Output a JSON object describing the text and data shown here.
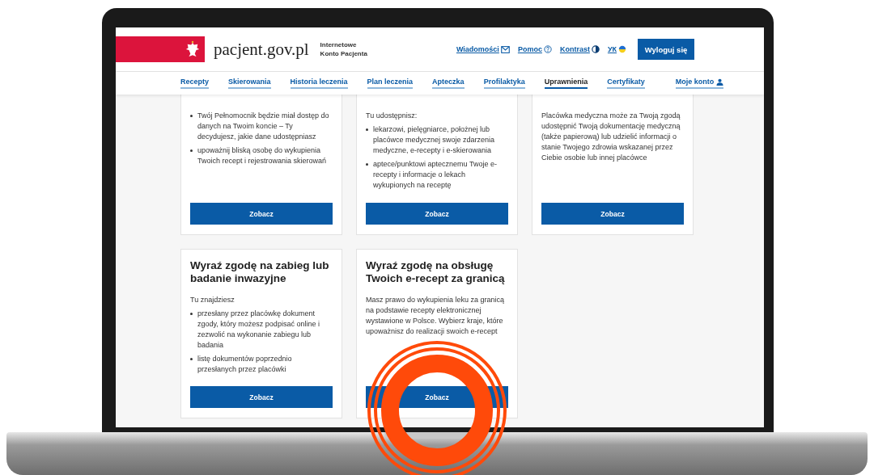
{
  "header": {
    "logo_text": "pacjent.gov.pl",
    "logo_subtitle": [
      "Internetowe",
      "Konto Pacjenta"
    ],
    "top_links": [
      {
        "label": "Wiadomości",
        "kind": "mail"
      },
      {
        "label": "Pomoc",
        "kind": "help"
      },
      {
        "label": "Kontrast",
        "kind": "contrast"
      },
      {
        "label": "УК",
        "kind": "flag"
      }
    ],
    "logout_button": "Wyloguj się"
  },
  "nav": {
    "items": [
      {
        "label": "Recepty",
        "selected": false
      },
      {
        "label": "Skierowania",
        "selected": false
      },
      {
        "label": "Historia leczenia",
        "selected": false
      },
      {
        "label": "Plan leczenia",
        "selected": false
      },
      {
        "label": "Apteczka",
        "selected": false
      },
      {
        "label": "Profilaktyka",
        "selected": false
      },
      {
        "label": "Uprawnienia",
        "selected": true
      },
      {
        "label": "Certyfikaty",
        "selected": false
      }
    ],
    "account_link": "Moje konto"
  },
  "cards": [
    {
      "bullets": [
        "Twój Pełnomocnik będzie miał dostęp do danych na Twoim koncie – Ty decydujesz, jakie dane udostępniasz",
        "upoważnij bliską osobę do wykupienia Twoich recept i rejestrowania skierowań"
      ],
      "button": "Zobacz"
    },
    {
      "intro": "Tu udostępnisz:",
      "bullets": [
        "lekarzowi, pielęgniarce, położnej lub placówce medycznej swoje zdarzenia medyczne, e-recepty i e-skierowania",
        "aptece/punktowi aptecznemu Twoje e-recepty i informacje o lekach wykupionych na receptę"
      ],
      "button": "Zobacz"
    },
    {
      "intro": "Placówka medyczna może za Twoją zgodą udostępnić Twoją dokumentację  medyczną (także papierową) lub udzielić informacji o stanie Twojego zdrowia wskazanej przez Ciebie osobie lub innej placówce",
      "button": "Zobacz"
    },
    {
      "title": "Wyraź zgodę na zabieg lub badanie inwazyjne",
      "intro": "Tu znajdziesz",
      "bullets": [
        "przesłany przez placówkę dokument zgody, który możesz podpisać online i zezwolić na wykonanie zabiegu lub badania",
        "listę dokumentów poprzednio przesłanych przez placówki"
      ],
      "button": "Zobacz"
    },
    {
      "title": "Wyraź zgodę na obsługę Twoich e-recept za granicą",
      "intro": "Masz prawo do wykupienia leku za granicą na podstawie recepty elektronicznej wystawione w Polsce. Wybierz kraje, które upoważnisz do realizacji swoich e-recept",
      "button": "Zobacz"
    }
  ]
}
